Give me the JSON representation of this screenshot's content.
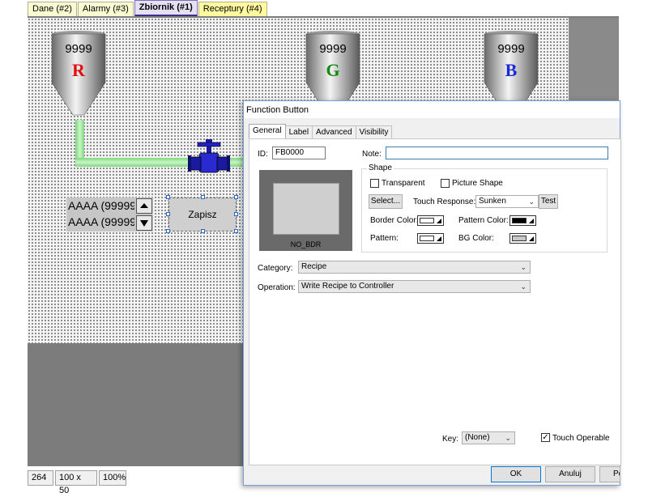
{
  "tabs": [
    {
      "label": "Dane (#2)"
    },
    {
      "label": "Alarmy (#3)"
    },
    {
      "label": "Zbiornik (#1)"
    },
    {
      "label": "Receptury (#4)"
    }
  ],
  "tanks": [
    {
      "value": "9999",
      "letter": "R",
      "color": "#e01010"
    },
    {
      "value": "9999",
      "letter": "G",
      "color": "#108a10"
    },
    {
      "value": "9999",
      "letter": "B",
      "color": "#1a2ad8"
    }
  ],
  "recipe": {
    "row1": "AAAA (99999",
    "row2": "AAAA (99999"
  },
  "save_button": {
    "label": "Zapisz"
  },
  "status": {
    "coord": "264",
    "size": "100 x 50",
    "zoom": "100%"
  },
  "dialog": {
    "title": "Function Button",
    "tabs": [
      "General",
      "Label",
      "Advanced",
      "Visibility"
    ],
    "id_label": "ID:",
    "id_value": "FB0000",
    "note_label": "Note:",
    "note_value": "",
    "preview_caption": "NO_BDR",
    "shape_title": "Shape",
    "transparent_label": "Transparent",
    "picture_shape_label": "Picture Shape",
    "select_label": "Select...",
    "touch_response_label": "Touch Response:",
    "touch_response_value": "Sunken",
    "test_label": "Test",
    "border_color_label": "Border Color:",
    "pattern_color_label": "Pattern Color:",
    "pattern_label": "Pattern:",
    "bg_color_label": "BG Color:",
    "category_label": "Category:",
    "category_value": "Recipe",
    "operation_label": "Operation:",
    "operation_value": "Write Recipe to Controller",
    "key_label": "Key:",
    "key_value": "(None)",
    "touch_operable_label": "Touch Operable",
    "ok_label": "OK",
    "cancel_label": "Anuluj",
    "help_label": "Po"
  }
}
